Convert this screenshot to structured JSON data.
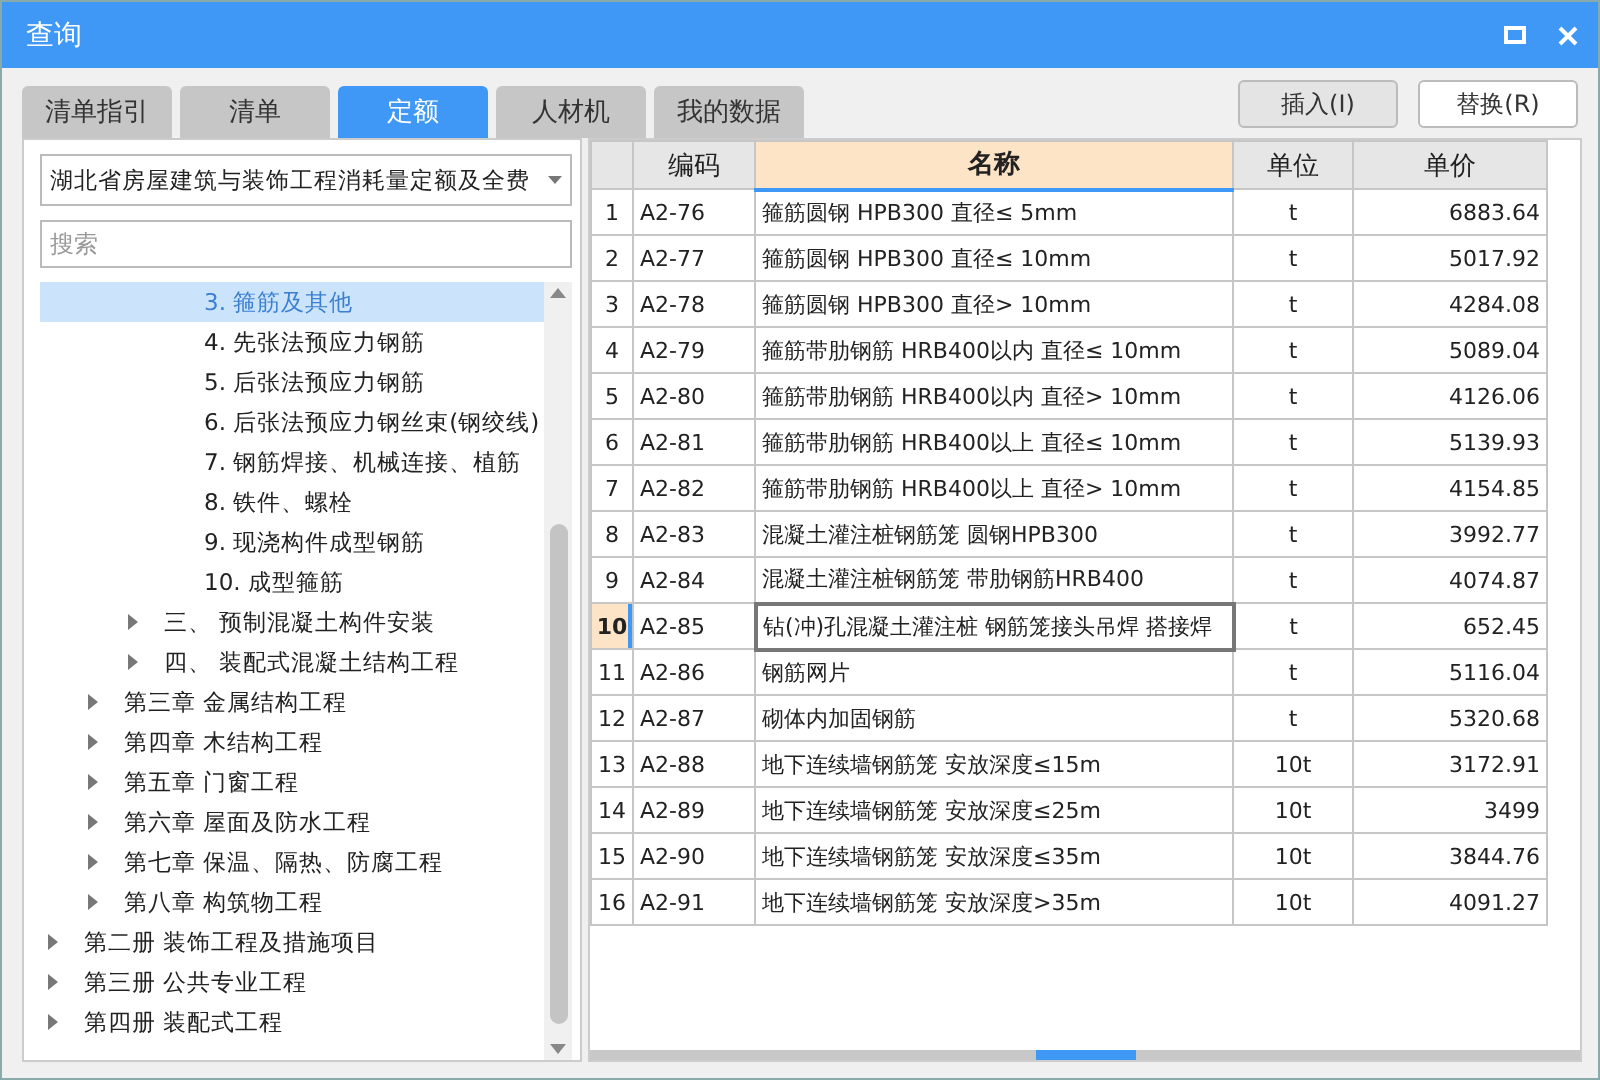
{
  "window": {
    "title": "查询"
  },
  "tabs": [
    {
      "label": "清单指引",
      "selected": false
    },
    {
      "label": "清单",
      "selected": false
    },
    {
      "label": "定额",
      "selected": true
    },
    {
      "label": "人材机",
      "selected": false
    },
    {
      "label": "我的数据",
      "selected": false
    }
  ],
  "buttons": [
    {
      "label": "插入(I)",
      "disabled": true
    },
    {
      "label": "替换(R)",
      "disabled": false
    }
  ],
  "library": {
    "value": "湖北省房屋建筑与装饰工程消耗量定额及全费"
  },
  "search": {
    "placeholder": "搜索"
  },
  "tree": [
    {
      "children": [
        {
          "children": [
            {
              "children": [
                {
                  "label": "3. 箍筋及其他",
                  "selected": true
                },
                {
                  "label": "4. 先张法预应力钢筋",
                  "selected": false
                },
                {
                  "label": "5. 后张法预应力钢筋",
                  "selected": false
                },
                {
                  "label": "6. 后张法预应力钢丝束(钢绞线)",
                  "selected": false
                },
                {
                  "label": "7. 钢筋焊接、机械连接、植筋",
                  "selected": false
                },
                {
                  "label": "8. 铁件、螺栓",
                  "selected": false
                },
                {
                  "label": "9. 现浇构件成型钢筋",
                  "selected": false
                },
                {
                  "label": "10. 成型箍筋",
                  "selected": false
                }
              ]
            },
            {
              "label": "三、 预制混凝土构件安装",
              "selected": false,
              "expanded": false
            },
            {
              "label": "四、 装配式混凝土结构工程",
              "selected": false,
              "expanded": false
            }
          ]
        },
        {
          "label": "第三章 金属结构工程",
          "selected": false,
          "expanded": false
        },
        {
          "label": "第四章 木结构工程",
          "selected": false,
          "expanded": false
        },
        {
          "label": "第五章 门窗工程",
          "selected": false,
          "expanded": false
        },
        {
          "label": "第六章 屋面及防水工程",
          "selected": false,
          "expanded": false
        },
        {
          "label": "第七章 保温、隔热、防腐工程",
          "selected": false,
          "expanded": false
        },
        {
          "label": "第八章 构筑物工程",
          "selected": false,
          "expanded": false
        }
      ]
    },
    {
      "label": "第二册 装饰工程及措施项目",
      "selected": false,
      "expanded": false
    },
    {
      "label": "第三册 公共专业工程",
      "selected": false,
      "expanded": false
    },
    {
      "label": "第四册 装配式工程",
      "selected": false,
      "expanded": false
    }
  ],
  "table": {
    "columns": [
      {
        "label": "编码",
        "selected": false
      },
      {
        "label": "名称",
        "selected": true
      },
      {
        "label": "单位",
        "selected": false
      },
      {
        "label": "单价",
        "selected": false
      }
    ],
    "rows": [
      {
        "no": "1",
        "code": "A2-76",
        "name": "箍筋圆钢 HPB300 直径≤ 5mm",
        "unit": "t",
        "price": "6883.64",
        "selected": false
      },
      {
        "no": "2",
        "code": "A2-77",
        "name": "箍筋圆钢 HPB300 直径≤ 10mm",
        "unit": "t",
        "price": "5017.92",
        "selected": false
      },
      {
        "no": "3",
        "code": "A2-78",
        "name": "箍筋圆钢 HPB300 直径> 10mm",
        "unit": "t",
        "price": "4284.08",
        "selected": false
      },
      {
        "no": "4",
        "code": "A2-79",
        "name": "箍筋带肋钢筋 HRB400以内 直径≤ 10mm",
        "unit": "t",
        "price": "5089.04",
        "selected": false
      },
      {
        "no": "5",
        "code": "A2-80",
        "name": "箍筋带肋钢筋 HRB400以内 直径> 10mm",
        "unit": "t",
        "price": "4126.06",
        "selected": false
      },
      {
        "no": "6",
        "code": "A2-81",
        "name": "箍筋带肋钢筋 HRB400以上 直径≤ 10mm",
        "unit": "t",
        "price": "5139.93",
        "selected": false
      },
      {
        "no": "7",
        "code": "A2-82",
        "name": "箍筋带肋钢筋 HRB400以上 直径> 10mm",
        "unit": "t",
        "price": "4154.85",
        "selected": false
      },
      {
        "no": "8",
        "code": "A2-83",
        "name": "混凝土灌注桩钢筋笼 圆钢HPB300",
        "unit": "t",
        "price": "3992.77",
        "selected": false
      },
      {
        "no": "9",
        "code": "A2-84",
        "name": "混凝土灌注桩钢筋笼 带肋钢筋HRB400",
        "unit": "t",
        "price": "4074.87",
        "selected": false
      },
      {
        "no": "10",
        "code": "A2-85",
        "name": "钻(冲)孔混凝土灌注桩 钢筋笼接头吊焊 搭接焊",
        "unit": "t",
        "price": "652.45",
        "selected": true
      },
      {
        "no": "11",
        "code": "A2-86",
        "name": "钢筋网片",
        "unit": "t",
        "price": "5116.04",
        "selected": false
      },
      {
        "no": "12",
        "code": "A2-87",
        "name": "砌体内加固钢筋",
        "unit": "t",
        "price": "5320.68",
        "selected": false
      },
      {
        "no": "13",
        "code": "A2-88",
        "name": "地下连续墙钢筋笼 安放深度≤15m",
        "unit": "10t",
        "price": "3172.91",
        "selected": false
      },
      {
        "no": "14",
        "code": "A2-89",
        "name": "地下连续墙钢筋笼 安放深度≤25m",
        "unit": "10t",
        "price": "3499",
        "selected": false
      },
      {
        "no": "15",
        "code": "A2-90",
        "name": "地下连续墙钢筋笼 安放深度≤35m",
        "unit": "10t",
        "price": "3844.76",
        "selected": false
      },
      {
        "no": "16",
        "code": "A2-91",
        "name": "地下连续墙钢筋笼 安放深度>35m",
        "unit": "10t",
        "price": "4091.27",
        "selected": false
      }
    ]
  }
}
